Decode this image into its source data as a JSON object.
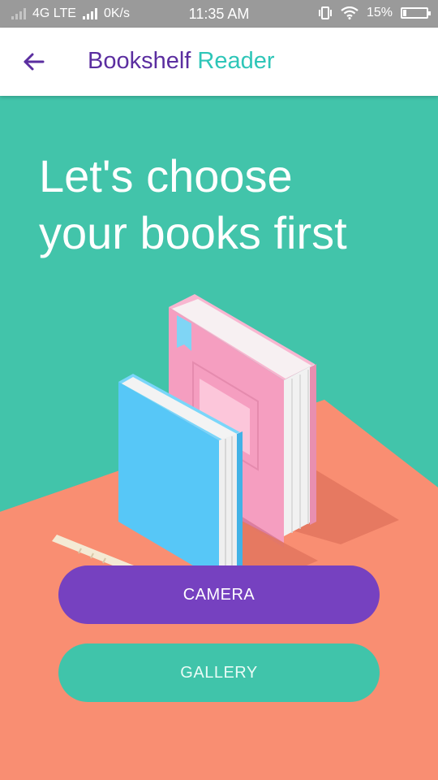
{
  "status_bar": {
    "network": "4G LTE",
    "speed": "0K/s",
    "time": "11:35 AM",
    "battery": "15%",
    "battery_level": 0.15
  },
  "app_bar": {
    "title_part1": "Bookshelf",
    "title_part2": "Reader"
  },
  "main": {
    "headline_line1": "Let's choose",
    "headline_line2": "your books first"
  },
  "buttons": {
    "camera": "CAMERA",
    "gallery": "GALLERY"
  },
  "colors": {
    "teal_background": "#42C4AA",
    "coral_floor": "#F98E72",
    "primary_purple": "#7641C0",
    "accent_teal": "#40C4AA"
  }
}
